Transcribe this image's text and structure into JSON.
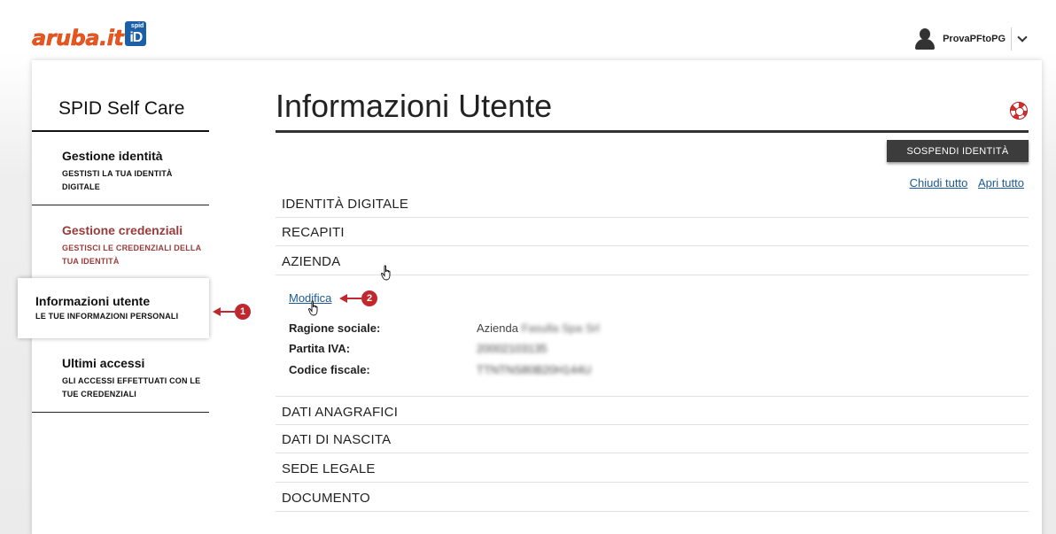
{
  "header": {
    "logo_text": "aruba.it",
    "logo_badge_top": "spid",
    "logo_badge_main": "iD",
    "user_name": "ProvaPFtoPG"
  },
  "sidebar": {
    "title": "SPID Self Care",
    "items": [
      {
        "label": "Gestione identità",
        "sub": "GESTISTI LA TUA IDENTITÀ DIGITALE"
      },
      {
        "label": "Gestione credenziali",
        "sub": "GESTISCI LE CREDENZIALI DELLA TUA IDENTITÀ"
      },
      {
        "label": "Informazioni utente",
        "sub": "LE TUE INFORMAZIONI PERSONALI"
      },
      {
        "label": "Ultimi accessi",
        "sub": "GLI ACCESSI EFFETTUATI CON LE TUE CREDENZIALI"
      }
    ]
  },
  "main": {
    "title": "Informazioni Utente",
    "suspend_button": "SOSPENDI IDENTITÀ",
    "close_all": "Chiudi tutto",
    "open_all": "Apri tutto",
    "sections": [
      "IDENTITÀ DIGITALE",
      "RECAPITI",
      "AZIENDA",
      "DATI ANAGRAFICI",
      "DATI DI NASCITA",
      "SEDE LEGALE",
      "DOCUMENTO"
    ],
    "azienda": {
      "edit_link": "Modifica",
      "fields": [
        {
          "label": "Ragione sociale:",
          "prefix": "Azienda",
          "value": "Fasulla Spa Srl"
        },
        {
          "label": "Partita IVA:",
          "prefix": "",
          "value": "20002103135"
        },
        {
          "label": "Codice fiscale:",
          "prefix": "",
          "value": "TTNTNS80B20H144U"
        }
      ]
    }
  },
  "callouts": {
    "one": "1",
    "two": "2"
  },
  "colors": {
    "accent_red": "#c0282d",
    "link_blue": "#1a5a96",
    "logo_orange": "#e8561c",
    "logo_blue": "#1b5fa8"
  }
}
